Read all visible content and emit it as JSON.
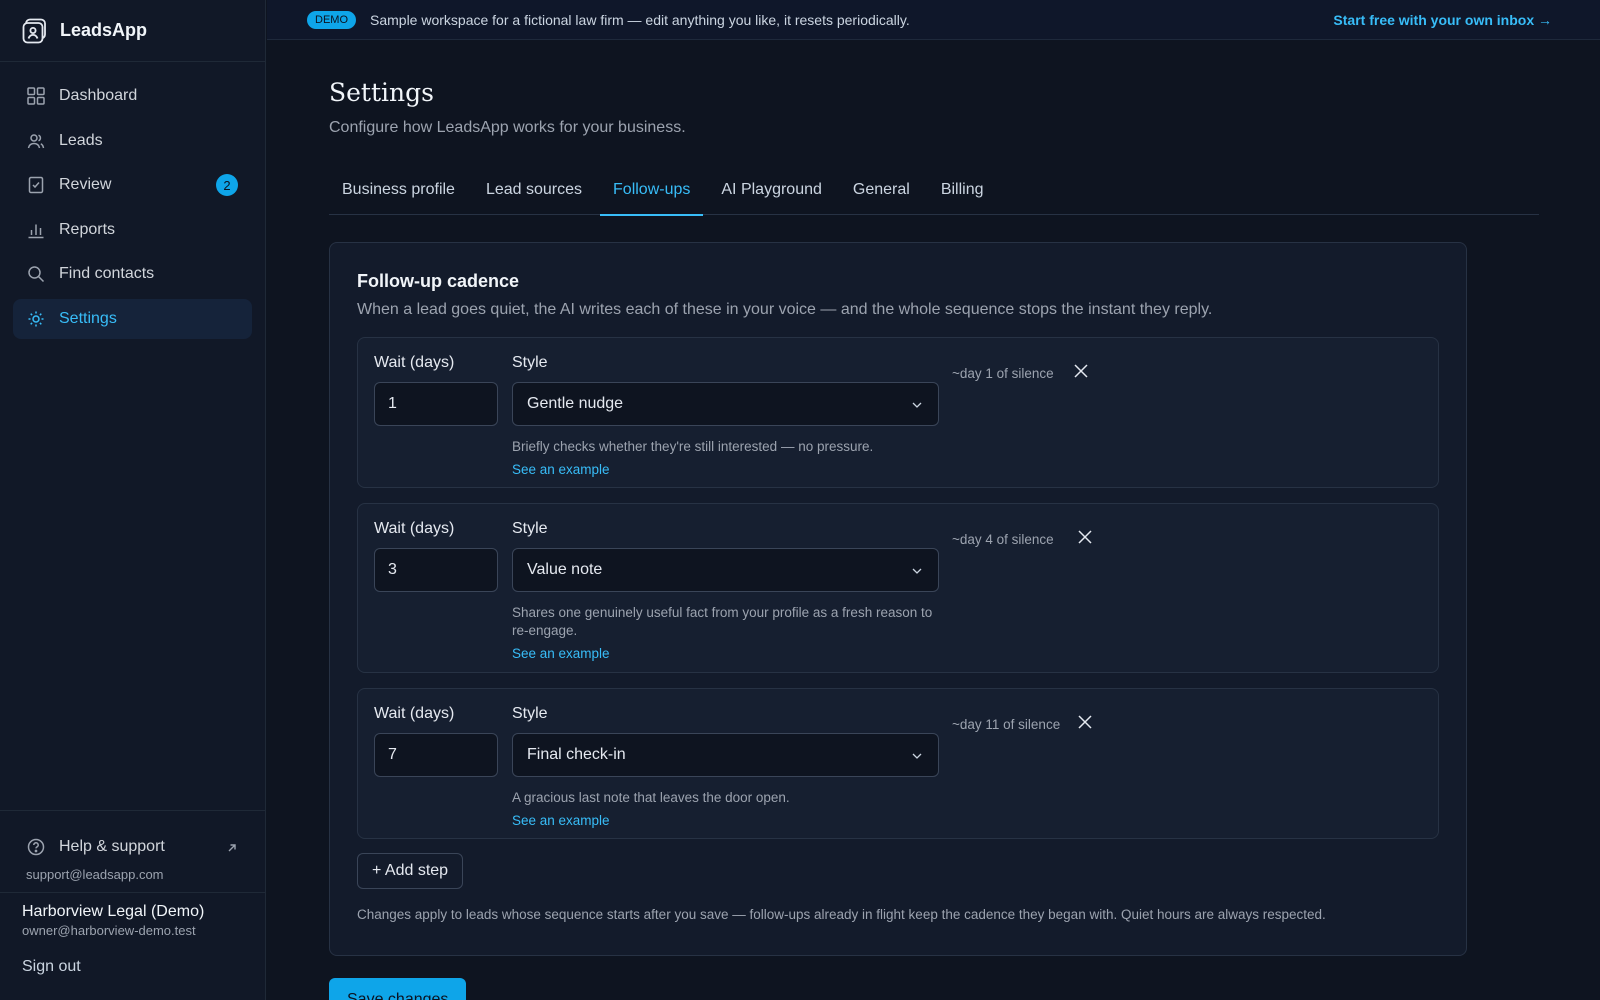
{
  "app": {
    "name": "LeadsApp"
  },
  "sidebar": {
    "items": [
      {
        "label": "Dashboard",
        "icon": "grid-icon"
      },
      {
        "label": "Leads",
        "icon": "users-icon"
      },
      {
        "label": "Review",
        "icon": "clipboard-check-icon",
        "badge": "2"
      },
      {
        "label": "Reports",
        "icon": "bar-chart-icon"
      },
      {
        "label": "Find contacts",
        "icon": "search-icon"
      },
      {
        "label": "Settings",
        "icon": "gear-icon",
        "active": true
      }
    ],
    "help_label": "Help & support",
    "support_email": "support@leadsapp.com",
    "user_name": "Harborview Legal (Demo)",
    "user_email": "owner@harborview-demo.test",
    "sign_out": "Sign out"
  },
  "topbar": {
    "pill": "DEMO",
    "text": "Sample workspace for a fictional law firm — edit anything you like, it resets periodically.",
    "cta": "Start free with your own inbox →"
  },
  "page": {
    "title": "Settings",
    "subtitle": "Configure how LeadsApp works for your business."
  },
  "tabs": [
    "Business profile",
    "Lead sources",
    "Follow-ups",
    "AI Playground",
    "General",
    "Billing"
  ],
  "active_tab": "Follow-ups",
  "cadence": {
    "title": "Follow-up cadence",
    "description": "When a lead goes quiet, the AI writes each of these in your voice — and the whole sequence stops the instant they reply.",
    "wait_label": "Wait (days)",
    "style_label": "Style",
    "example_label": "See an example",
    "steps": [
      {
        "wait": "1",
        "style": "Gentle nudge",
        "desc": "Briefly checks whether they're still interested — no pressure.",
        "silence": "~day 1 of silence"
      },
      {
        "wait": "3",
        "style": "Value note",
        "desc": "Shares one genuinely useful fact from your profile as a fresh reason to re-engage.",
        "silence": "~day 4 of silence"
      },
      {
        "wait": "7",
        "style": "Final check-in",
        "desc": "A gracious last note that leaves the door open.",
        "silence": "~day 11 of silence"
      }
    ],
    "add_step": "+ Add step",
    "footnote": "Changes apply to leads whose sequence starts after you save — follow-ups already in flight keep the cadence they began with. Quiet hours are always respected."
  },
  "save_label": "Save changes",
  "colors": {
    "accent": "#38bdf8",
    "accent_solid": "#0ea5e9",
    "background": "#0e1420"
  }
}
